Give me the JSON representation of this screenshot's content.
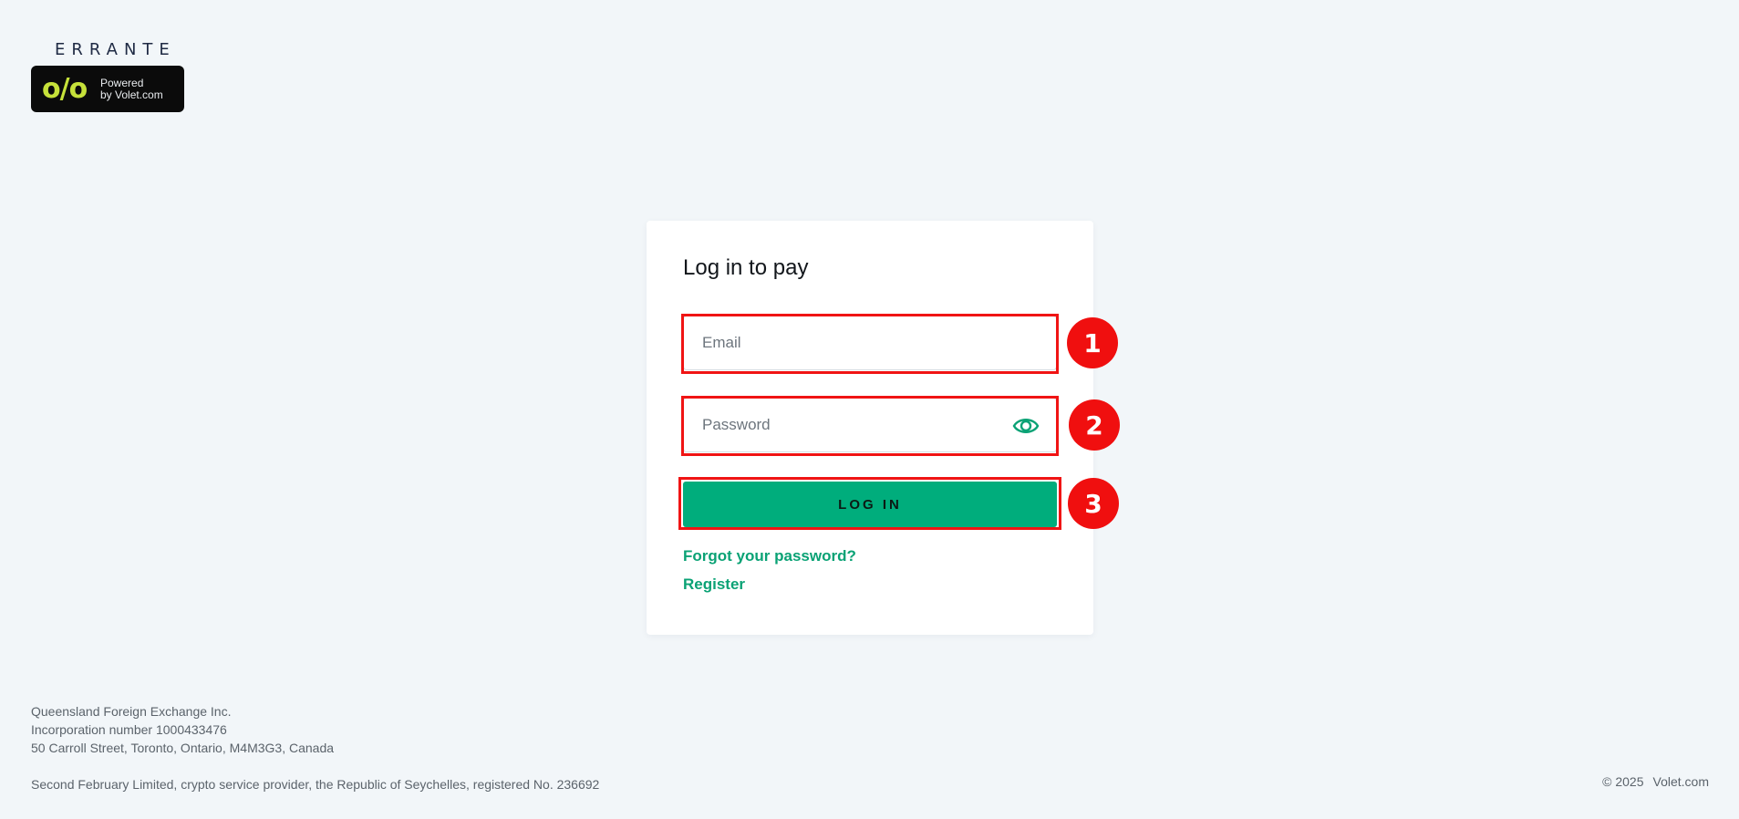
{
  "brand": {
    "errante_logo_text": "ERRANTE",
    "powered_line1": "Powered",
    "powered_line2": "by Volet.com",
    "volet_mark": "o/o",
    "accent_color": "#00ad7c",
    "logo_red": "#e0262c"
  },
  "login": {
    "title": "Log in to pay",
    "email_placeholder": "Email",
    "password_placeholder": "Password",
    "login_button_label": "LOG IN",
    "forgot_link": "Forgot your password?",
    "register_link": "Register",
    "eye_icon": "eye-icon"
  },
  "annotations": {
    "badge_1": "1",
    "badge_2": "2",
    "badge_3": "3",
    "color": "#f01414"
  },
  "footer": {
    "company_line1": "Queensland Foreign Exchange Inc.",
    "company_line2": "Incorporation number 1000433476",
    "company_line3": "50 Carroll Street, Toronto, Ontario, M4M3G3, Canada",
    "crypto_line": "Second February Limited, crypto service provider, the Republic of Seychelles, registered No. 236692",
    "copyright": "© 2025",
    "site": "Volet.com"
  }
}
